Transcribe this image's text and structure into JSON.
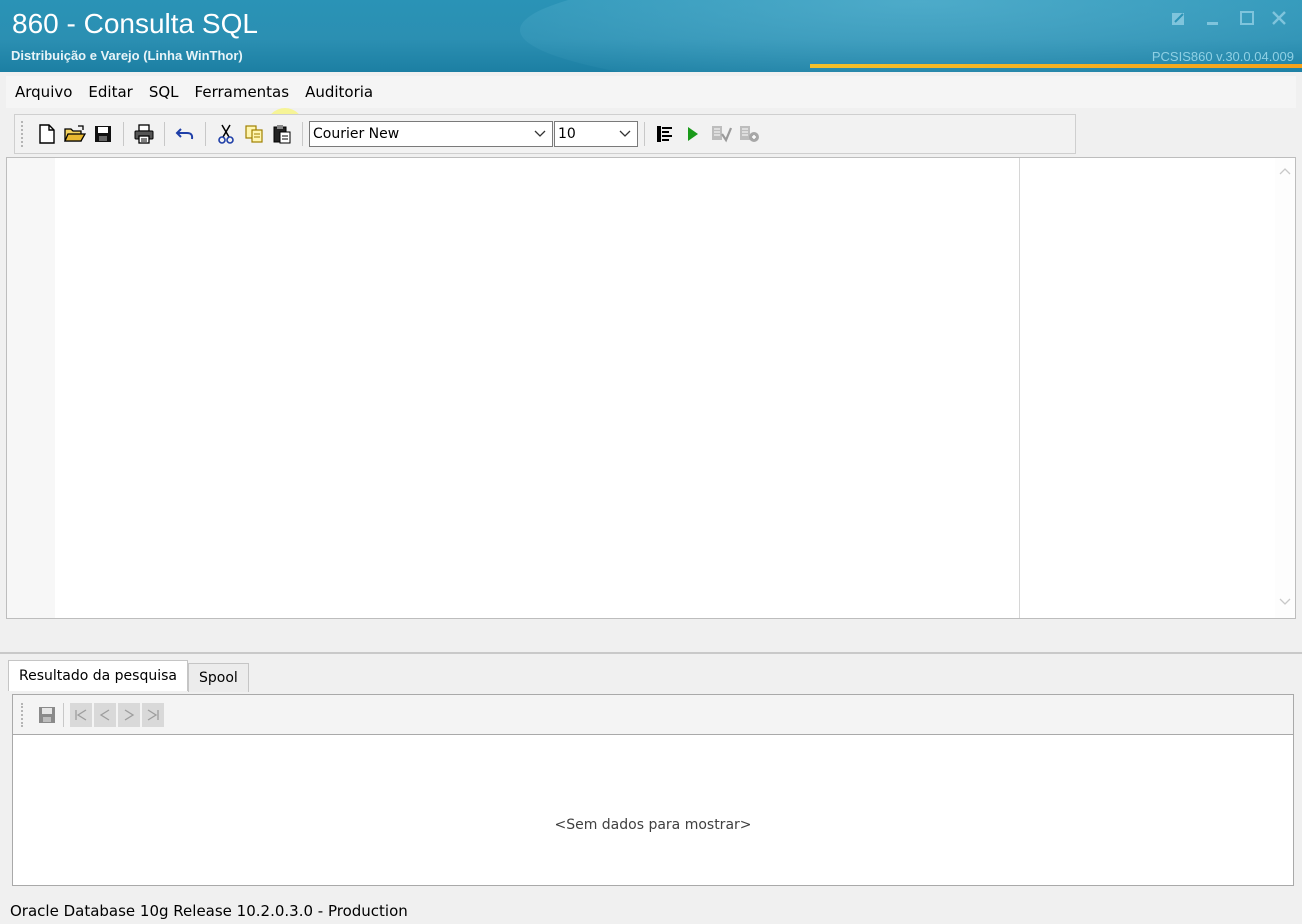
{
  "window": {
    "title": "860 - Consulta SQL",
    "subtitle": "Distribuição e Varejo (Linha WinThor)",
    "version": "PCSIS860  v.30.0.04.009",
    "controls": [
      "restore-icon",
      "minimize-icon",
      "maximize-icon",
      "close-icon"
    ]
  },
  "menu": {
    "items": [
      "Arquivo",
      "Editar",
      "SQL",
      "Ferramentas",
      "Auditoria"
    ]
  },
  "toolbar": {
    "icons": [
      "new-file-icon",
      "open-folder-icon",
      "save-icon",
      "print-icon",
      "undo-icon",
      "cut-icon",
      "copy-icon",
      "paste-icon",
      "format-sql-icon",
      "run-icon",
      "run-script-icon",
      "explain-plan-icon"
    ],
    "font_name": "Courier New",
    "font_size": "10"
  },
  "tabs": {
    "results": "Resultado da pesquisa",
    "spool": "Spool"
  },
  "results": {
    "empty_message": "<Sem dados para mostrar>",
    "nav_icons": [
      "save-results-icon",
      "first-record-icon",
      "prior-record-icon",
      "next-record-icon",
      "last-record-icon"
    ]
  },
  "status": {
    "text": "Oracle Database 10g Release 10.2.0.3.0 - Production"
  },
  "colors": {
    "titlebar": "#2a93b6",
    "accent": "#f3c02a",
    "run_green": "#1a9a1a"
  }
}
